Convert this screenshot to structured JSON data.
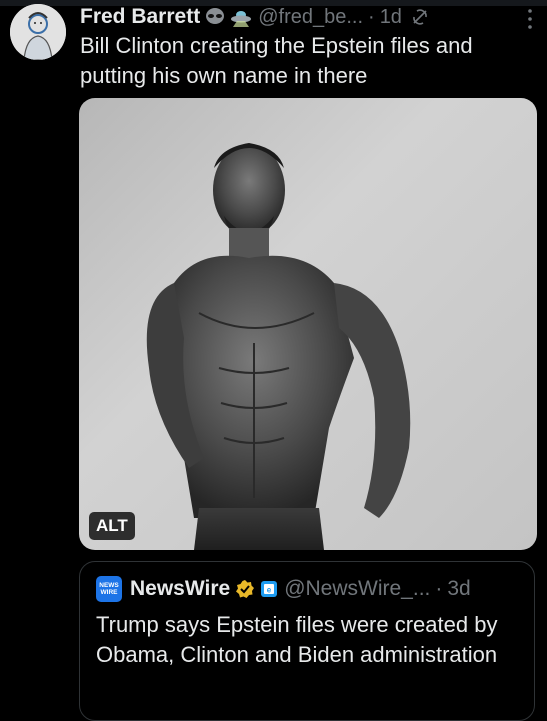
{
  "post": {
    "author_name": "Fred Barrett",
    "handle": "@fred_be...",
    "separator": "·",
    "time": "1d",
    "text": "Bill Clinton creating the Epstein files and putting his own name in there",
    "name_emojis": [
      "alien-emoji",
      "ufo-emoji"
    ]
  },
  "media": {
    "alt_label": "ALT"
  },
  "quote": {
    "avatar_text_line1": "NEWS",
    "avatar_text_line2": "WIRE",
    "author_name": "NewsWire",
    "handle": "@NewsWire_...",
    "separator": "·",
    "time": "3d",
    "text": "Trump says Epstein files were created by Obama, Clinton and Biden administration",
    "verified_color": "#e8b829",
    "affiliate_color": "#1d9bf0"
  },
  "theme": {
    "background": "#000000",
    "text_primary": "#e7e9ea",
    "text_secondary": "#71767b",
    "border": "#2f3336"
  }
}
